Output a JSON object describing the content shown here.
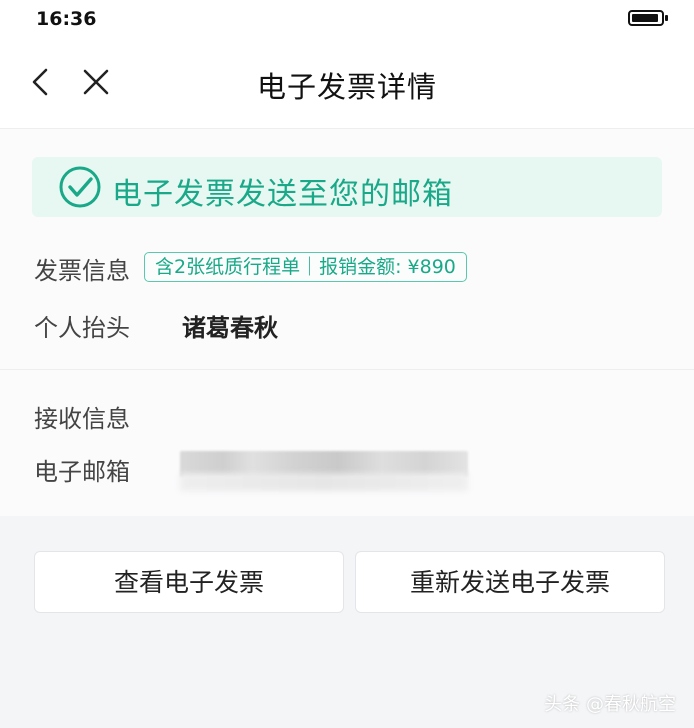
{
  "status_bar": {
    "time": "16:36",
    "battery_icon": "battery-icon"
  },
  "nav": {
    "title": "电子发票详情",
    "back_icon": "chevron-left-icon",
    "close_icon": "close-icon"
  },
  "banner": {
    "text": "电子发票发送至您的邮箱",
    "icon": "check-circle-icon",
    "background": "#e7f7f2",
    "accent": "#1aa988"
  },
  "invoice_info": {
    "label": "发票信息",
    "tag": "含2张纸质行程单｜报销金额: ¥890"
  },
  "header": {
    "label": "个人抬头",
    "value": "诸葛春秋"
  },
  "receive_info": {
    "label": "接收信息",
    "email_label": "电子邮箱"
  },
  "buttons": {
    "view": "查看电子发票",
    "resend": "重新发送电子发票"
  },
  "watermark": "头条 @春秋航空"
}
